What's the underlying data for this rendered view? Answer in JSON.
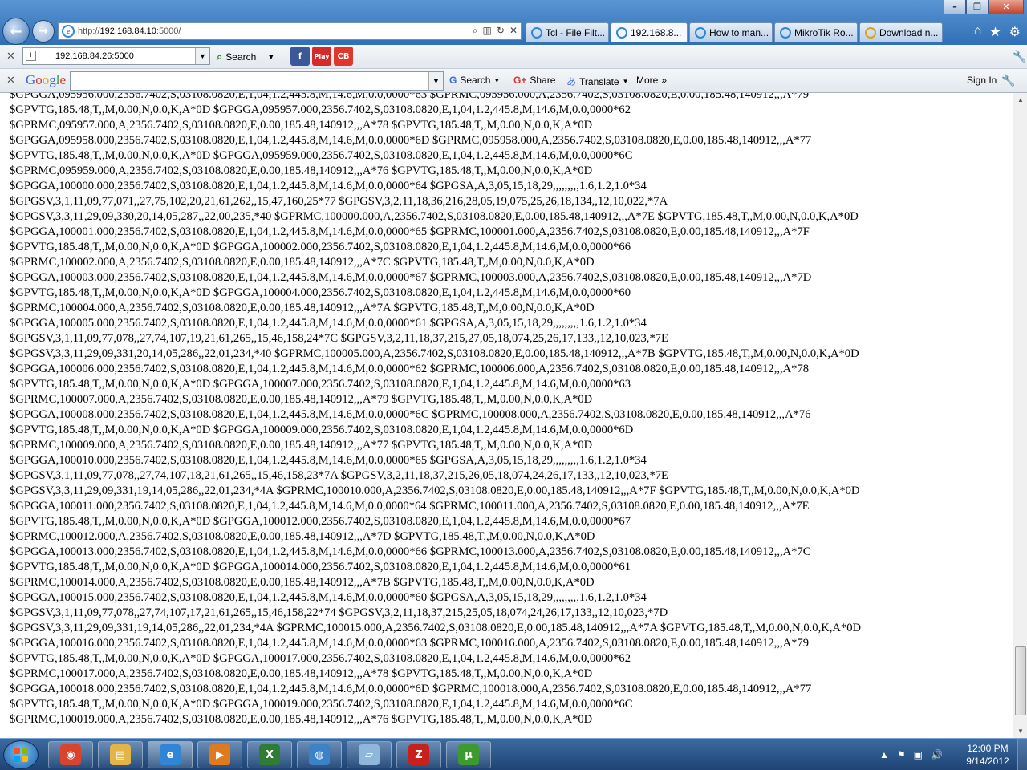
{
  "browser": {
    "address_scheme": "http://",
    "address_host": "192.168.84.10",
    "address_rest": ":5000/",
    "window_controls": {
      "minimize": "–",
      "restore": "❐",
      "close": "✕"
    },
    "tabs": [
      {
        "label": "Tcl - File Filt...",
        "active": false
      },
      {
        "label": "192.168.8...",
        "active": true
      },
      {
        "label": "How to man...",
        "active": false
      },
      {
        "label": "MikroTik Ro...",
        "active": false
      },
      {
        "label": "Download n...",
        "active": false
      }
    ],
    "right_icons": [
      "home-icon",
      "star-icon",
      "gear-icon"
    ]
  },
  "toolbar1": {
    "close_glyph": "✕",
    "site_value": "192.168.84.26:5000",
    "search_label": "Search",
    "addons": [
      {
        "name": "facebook-addon-icon",
        "text": "f",
        "color": "#3b5998"
      },
      {
        "name": "playvids-addon-icon",
        "text": "Play",
        "color": "#d42a2a"
      },
      {
        "name": "cb-addon-icon",
        "text": "CB",
        "color": "#e0362c"
      }
    ]
  },
  "toolbar2": {
    "close_glyph": "✕",
    "logo": "Google",
    "search_label": "Search",
    "share_label": "Share",
    "translate_label": "Translate",
    "more_label": "More",
    "signin_label": "Sign In"
  },
  "content": {
    "lines": [
      "$GPGGA,095956.000,2356.7402,S,03108.0820,E,1,04,1.2,445.8,M,14.6,M,0.0,0000*63 $GPRMC,095956.000,A,2356.7402,S,03108.0820,E,0.00,185.48,140912,,,A*79",
      "$GPVTG,185.48,T,,M,0.00,N,0.0,K,A*0D $GPGGA,095957.000,2356.7402,S,03108.0820,E,1,04,1.2,445.8,M,14.6,M,0.0,0000*62",
      "$GPRMC,095957.000,A,2356.7402,S,03108.0820,E,0.00,185.48,140912,,,A*78 $GPVTG,185.48,T,,M,0.00,N,0.0,K,A*0D",
      "$GPGGA,095958.000,2356.7402,S,03108.0820,E,1,04,1.2,445.8,M,14.6,M,0.0,0000*6D $GPRMC,095958.000,A,2356.7402,S,03108.0820,E,0.00,185.48,140912,,,A*77",
      "$GPVTG,185.48,T,,M,0.00,N,0.0,K,A*0D $GPGGA,095959.000,2356.7402,S,03108.0820,E,1,04,1.2,445.8,M,14.6,M,0.0,0000*6C",
      "$GPRMC,095959.000,A,2356.7402,S,03108.0820,E,0.00,185.48,140912,,,A*76 $GPVTG,185.48,T,,M,0.00,N,0.0,K,A*0D",
      "$GPGGA,100000.000,2356.7402,S,03108.0820,E,1,04,1.2,445.8,M,14.6,M,0.0,0000*64 $GPGSA,A,3,05,15,18,29,,,,,,,,,1.6,1.2,1.0*34",
      "$GPGSV,3,1,11,09,77,071,,27,75,102,20,21,61,262,,15,47,160,25*77 $GPGSV,3,2,11,18,36,216,28,05,19,075,25,26,18,134,,12,10,022,*7A",
      "$GPGSV,3,3,11,29,09,330,20,14,05,287,,22,00,235,*40 $GPRMC,100000.000,A,2356.7402,S,03108.0820,E,0.00,185.48,140912,,,A*7E $GPVTG,185.48,T,,M,0.00,N,0.0,K,A*0D",
      "$GPGGA,100001.000,2356.7402,S,03108.0820,E,1,04,1.2,445.8,M,14.6,M,0.0,0000*65 $GPRMC,100001.000,A,2356.7402,S,03108.0820,E,0.00,185.48,140912,,,A*7F",
      "$GPVTG,185.48,T,,M,0.00,N,0.0,K,A*0D $GPGGA,100002.000,2356.7402,S,03108.0820,E,1,04,1.2,445.8,M,14.6,M,0.0,0000*66",
      "$GPRMC,100002.000,A,2356.7402,S,03108.0820,E,0.00,185.48,140912,,,A*7C $GPVTG,185.48,T,,M,0.00,N,0.0,K,A*0D",
      "$GPGGA,100003.000,2356.7402,S,03108.0820,E,1,04,1.2,445.8,M,14.6,M,0.0,0000*67 $GPRMC,100003.000,A,2356.7402,S,03108.0820,E,0.00,185.48,140912,,,A*7D",
      "$GPVTG,185.48,T,,M,0.00,N,0.0,K,A*0D $GPGGA,100004.000,2356.7402,S,03108.0820,E,1,04,1.2,445.8,M,14.6,M,0.0,0000*60",
      "$GPRMC,100004.000,A,2356.7402,S,03108.0820,E,0.00,185.48,140912,,,A*7A $GPVTG,185.48,T,,M,0.00,N,0.0,K,A*0D",
      "$GPGGA,100005.000,2356.7402,S,03108.0820,E,1,04,1.2,445.8,M,14.6,M,0.0,0000*61 $GPGSA,A,3,05,15,18,29,,,,,,,,,1.6,1.2,1.0*34",
      "$GPGSV,3,1,11,09,77,078,,27,74,107,19,21,61,265,,15,46,158,24*7C $GPGSV,3,2,11,18,37,215,27,05,18,074,25,26,17,133,,12,10,023,*7E",
      "$GPGSV,3,3,11,29,09,331,20,14,05,286,,22,01,234,*40 $GPRMC,100005.000,A,2356.7402,S,03108.0820,E,0.00,185.48,140912,,,A*7B $GPVTG,185.48,T,,M,0.00,N,0.0,K,A*0D",
      "$GPGGA,100006.000,2356.7402,S,03108.0820,E,1,04,1.2,445.8,M,14.6,M,0.0,0000*62 $GPRMC,100006.000,A,2356.7402,S,03108.0820,E,0.00,185.48,140912,,,A*78",
      "$GPVTG,185.48,T,,M,0.00,N,0.0,K,A*0D $GPGGA,100007.000,2356.7402,S,03108.0820,E,1,04,1.2,445.8,M,14.6,M,0.0,0000*63",
      "$GPRMC,100007.000,A,2356.7402,S,03108.0820,E,0.00,185.48,140912,,,A*79 $GPVTG,185.48,T,,M,0.00,N,0.0,K,A*0D",
      "$GPGGA,100008.000,2356.7402,S,03108.0820,E,1,04,1.2,445.8,M,14.6,M,0.0,0000*6C $GPRMC,100008.000,A,2356.7402,S,03108.0820,E,0.00,185.48,140912,,,A*76",
      "$GPVTG,185.48,T,,M,0.00,N,0.0,K,A*0D $GPGGA,100009.000,2356.7402,S,03108.0820,E,1,04,1.2,445.8,M,14.6,M,0.0,0000*6D",
      "$GPRMC,100009.000,A,2356.7402,S,03108.0820,E,0.00,185.48,140912,,,A*77 $GPVTG,185.48,T,,M,0.00,N,0.0,K,A*0D",
      "$GPGGA,100010.000,2356.7402,S,03108.0820,E,1,04,1.2,445.8,M,14.6,M,0.0,0000*65 $GPGSA,A,3,05,15,18,29,,,,,,,,,1.6,1.2,1.0*34",
      "$GPGSV,3,1,11,09,77,078,,27,74,107,18,21,61,265,,15,46,158,23*7A $GPGSV,3,2,11,18,37,215,26,05,18,074,24,26,17,133,,12,10,023,*7E",
      "$GPGSV,3,3,11,29,09,331,19,14,05,286,,22,01,234,*4A $GPRMC,100010.000,A,2356.7402,S,03108.0820,E,0.00,185.48,140912,,,A*7F $GPVTG,185.48,T,,M,0.00,N,0.0,K,A*0D",
      "$GPGGA,100011.000,2356.7402,S,03108.0820,E,1,04,1.2,445.8,M,14.6,M,0.0,0000*64 $GPRMC,100011.000,A,2356.7402,S,03108.0820,E,0.00,185.48,140912,,,A*7E",
      "$GPVTG,185.48,T,,M,0.00,N,0.0,K,A*0D $GPGGA,100012.000,2356.7402,S,03108.0820,E,1,04,1.2,445.8,M,14.6,M,0.0,0000*67",
      "$GPRMC,100012.000,A,2356.7402,S,03108.0820,E,0.00,185.48,140912,,,A*7D $GPVTG,185.48,T,,M,0.00,N,0.0,K,A*0D",
      "$GPGGA,100013.000,2356.7402,S,03108.0820,E,1,04,1.2,445.8,M,14.6,M,0.0,0000*66 $GPRMC,100013.000,A,2356.7402,S,03108.0820,E,0.00,185.48,140912,,,A*7C",
      "$GPVTG,185.48,T,,M,0.00,N,0.0,K,A*0D $GPGGA,100014.000,2356.7402,S,03108.0820,E,1,04,1.2,445.8,M,14.6,M,0.0,0000*61",
      "$GPRMC,100014.000,A,2356.7402,S,03108.0820,E,0.00,185.48,140912,,,A*7B $GPVTG,185.48,T,,M,0.00,N,0.0,K,A*0D",
      "$GPGGA,100015.000,2356.7402,S,03108.0820,E,1,04,1.2,445.8,M,14.6,M,0.0,0000*60 $GPGSA,A,3,05,15,18,29,,,,,,,,,1.6,1.2,1.0*34",
      "$GPGSV,3,1,11,09,77,078,,27,74,107,17,21,61,265,,15,46,158,22*74 $GPGSV,3,2,11,18,37,215,25,05,18,074,24,26,17,133,,12,10,023,*7D",
      "$GPGSV,3,3,11,29,09,331,19,14,05,286,,22,01,234,*4A $GPRMC,100015.000,A,2356.7402,S,03108.0820,E,0.00,185.48,140912,,,A*7A $GPVTG,185.48,T,,M,0.00,N,0.0,K,A*0D",
      "$GPGGA,100016.000,2356.7402,S,03108.0820,E,1,04,1.2,445.8,M,14.6,M,0.0,0000*63 $GPRMC,100016.000,A,2356.7402,S,03108.0820,E,0.00,185.48,140912,,,A*79",
      "$GPVTG,185.48,T,,M,0.00,N,0.0,K,A*0D $GPGGA,100017.000,2356.7402,S,03108.0820,E,1,04,1.2,445.8,M,14.6,M,0.0,0000*62",
      "$GPRMC,100017.000,A,2356.7402,S,03108.0820,E,0.00,185.48,140912,,,A*78 $GPVTG,185.48,T,,M,0.00,N,0.0,K,A*0D",
      "$GPGGA,100018.000,2356.7402,S,03108.0820,E,1,04,1.2,445.8,M,14.6,M,0.0,0000*6D $GPRMC,100018.000,A,2356.7402,S,03108.0820,E,0.00,185.48,140912,,,A*77",
      "$GPVTG,185.48,T,,M,0.00,N,0.0,K,A*0D $GPGGA,100019.000,2356.7402,S,03108.0820,E,1,04,1.2,445.8,M,14.6,M,0.0,0000*6C",
      "$GPRMC,100019.000,A,2356.7402,S,03108.0820,E,0.00,185.48,140912,,,A*76 $GPVTG,185.48,T,,M,0.00,N,0.0,K,A*0D"
    ]
  },
  "taskbar": {
    "apps": [
      {
        "name": "chrome-icon",
        "text": "◉",
        "color": "#d9442f",
        "active": false
      },
      {
        "name": "file-explorer-icon",
        "text": "▤",
        "color": "#e3b448",
        "active": false
      },
      {
        "name": "internet-explorer-icon",
        "text": "e",
        "color": "#2f86d6",
        "active": true
      },
      {
        "name": "media-player-icon",
        "text": "▶",
        "color": "#e07a1f",
        "active": false
      },
      {
        "name": "excel-icon",
        "text": "X",
        "color": "#2f7d32",
        "active": false
      },
      {
        "name": "network-icon",
        "text": "◍",
        "color": "#3a83c6",
        "active": false
      },
      {
        "name": "notepad-icon",
        "text": "▱",
        "color": "#8fb7dc",
        "active": false
      },
      {
        "name": "filezilla-icon",
        "text": "Z",
        "color": "#c8201a",
        "active": false
      },
      {
        "name": "utorrent-icon",
        "text": "µ",
        "color": "#3c9a2f",
        "active": false
      }
    ],
    "time": "12:00 PM",
    "date": "9/14/2012"
  }
}
